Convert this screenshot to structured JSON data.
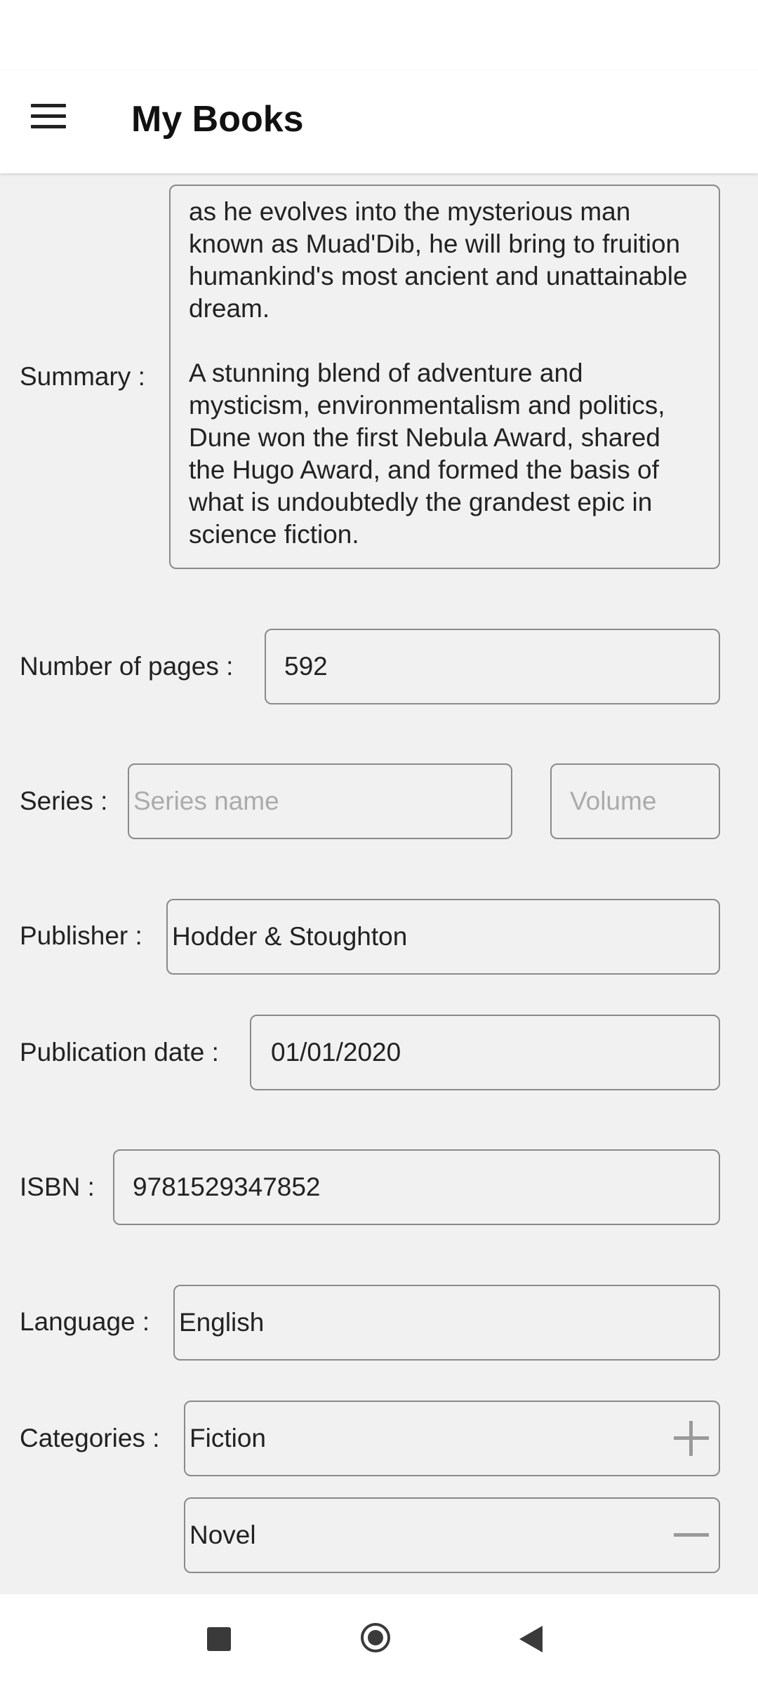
{
  "app": {
    "title": "My Books"
  },
  "form": {
    "summary": {
      "label": "Summary :",
      "paragraphs": [
        "as he evolves into the mysterious man known as Muad'Dib, he will bring to fruition humankind's most ancient and unattainable dream.",
        "A stunning blend of adventure and mysticism, environmentalism and politics, Dune won the first Nebula Award, shared the Hugo Award, and formed the basis of what is undoubtedly the grandest epic in science fiction."
      ]
    },
    "pages": {
      "label": "Number of pages :",
      "value": "592"
    },
    "series": {
      "label": "Series :",
      "name_placeholder": "Series name",
      "volume_placeholder": "Volume"
    },
    "publisher": {
      "label": "Publisher :",
      "value": "Hodder & Stoughton"
    },
    "publication_date": {
      "label": "Publication date :",
      "value": "01/01/2020"
    },
    "isbn": {
      "label": "ISBN :",
      "value": "9781529347852"
    },
    "language": {
      "label": "Language :",
      "value": "English"
    },
    "categories": {
      "label": "Categories :",
      "items": [
        "Fiction",
        "Novel"
      ]
    }
  },
  "icons": {
    "menu": "hamburger-menu-icon",
    "add_category": "plus-icon",
    "remove_category": "minus-icon",
    "nav_recents": "square-icon",
    "nav_home": "circle-icon",
    "nav_back": "triangle-back-icon"
  }
}
